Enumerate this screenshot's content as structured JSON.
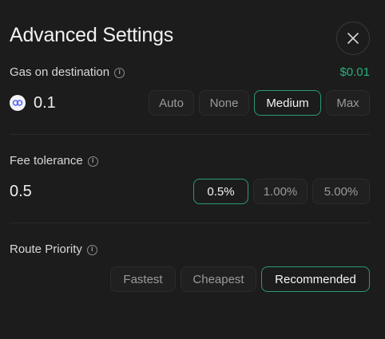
{
  "header": {
    "title": "Advanced Settings",
    "close_icon": "close-icon"
  },
  "gas": {
    "label": "Gas on destination",
    "cost": "$0.01",
    "cost_color": "#27b07a",
    "value": "0.1",
    "token_icon": "link-token-icon",
    "options": [
      "Auto",
      "None",
      "Medium",
      "Max"
    ],
    "selected": "Medium"
  },
  "fee": {
    "label": "Fee tolerance",
    "value": "0.5",
    "options": [
      "0.5%",
      "1.00%",
      "5.00%"
    ],
    "selected": "0.5%"
  },
  "route": {
    "label": "Route Priority",
    "options": [
      "Fastest",
      "Cheapest",
      "Recommended"
    ],
    "selected": "Recommended"
  },
  "accent_color": "#2d9a72"
}
